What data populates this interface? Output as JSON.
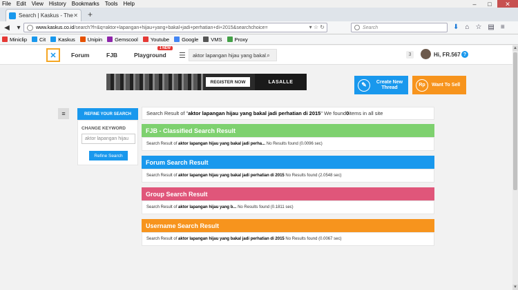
{
  "browser": {
    "menu": [
      "File",
      "Edit",
      "View",
      "History",
      "Bookmarks",
      "Tools",
      "Help"
    ],
    "tab_title": "Search | Kaskus - The Large...",
    "url_host": "www.kaskus.co.id",
    "url_path": "/search?f=&q=aktor+lapangan+hijau+yang+bakal+jadi+perhatian+di+2015&searchchoice=",
    "search_placeholder": "Search",
    "bookmarks": [
      {
        "label": "Miniclip",
        "color": "#e53935"
      },
      {
        "label": "Cit",
        "color": "#1998ed"
      },
      {
        "label": "Kaskus",
        "color": "#1998ed"
      },
      {
        "label": "Unipin",
        "color": "#e65100"
      },
      {
        "label": "Gemscool",
        "color": "#8e24aa"
      },
      {
        "label": "Youtube",
        "color": "#e53935"
      },
      {
        "label": "Google",
        "color": "#4285f4"
      },
      {
        "label": "VMS",
        "color": "#555555"
      },
      {
        "label": "Proxy",
        "color": "#43a047"
      }
    ]
  },
  "header": {
    "nav": [
      "Forum",
      "FJB",
      "Playground"
    ],
    "new_badge": "1 NEW",
    "search_value": "aktor lapangan hijau yang bakal",
    "notif_count": "3",
    "greeting": "Hi, FR.567"
  },
  "banner": {
    "cta": "REGISTER NOW",
    "brand": "LASALLE"
  },
  "actions": {
    "create_thread": "Create New Thread",
    "want_to_sell": "Want To Sell",
    "create_icon_text": "✎",
    "sell_icon_text": "Rp"
  },
  "sidebar": {
    "tab_label": "REFINE YOUR SEARCH",
    "change_keyword": "CHANGE KEYWORD",
    "keyword_value": "aktor lapangan hijau",
    "refine_button": "Refine Search"
  },
  "summary": {
    "prefix": "Search Result of \"",
    "query": "aktor lapangan hijau yang bakal jadi perhatian di 2015",
    "middle": "\" We found ",
    "count": "0",
    "suffix": " items in all site"
  },
  "sections": {
    "fjb": {
      "title": "FJB - Classified Search Result",
      "prefix": "Search Result of ",
      "query": "aktor lapangan hijau yang bakal jadi perha...",
      "result": " No Results found (0.0096 sec)"
    },
    "forum": {
      "title": "Forum Search Result",
      "prefix": "Search Result of ",
      "query": "aktor lapangan hijau yang bakal jadi perhatian di 2015",
      "result": " No Results found (2.0548 sec)"
    },
    "group": {
      "title": "Group Search Result",
      "prefix": "Search Result of ",
      "query": "aktor lapangan hijau yang b...",
      "result": " No Results found (0.1811 sec)"
    },
    "user": {
      "title": "Username Search Result",
      "prefix": "Search Result of ",
      "query": "aktor lapangan hijau yang bakal jadi perhatian di 2015",
      "result": " No Results found (0.0067 sec)"
    }
  }
}
